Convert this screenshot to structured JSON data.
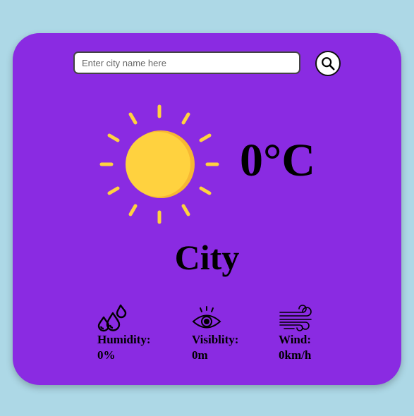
{
  "search": {
    "placeholder": "Enter city name here",
    "value": ""
  },
  "weather": {
    "icon": "sun-icon",
    "temperature": "0°C",
    "city": "City"
  },
  "details": {
    "humidity": {
      "icon": "humidity-drops-icon",
      "label": "Humidity:",
      "value": "0%"
    },
    "visibility": {
      "icon": "eye-icon",
      "label": "Visiblity:",
      "value": "0m"
    },
    "wind": {
      "icon": "wind-icon",
      "label": "Wind:",
      "value": "0km/h"
    }
  },
  "colors": {
    "background": "#add8e6",
    "card": "#8a2be2",
    "sun": "#ffd23f",
    "sun_shade": "#f7b733"
  }
}
